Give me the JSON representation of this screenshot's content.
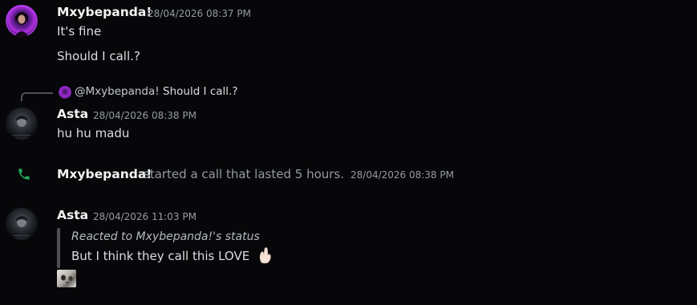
{
  "messages": [
    {
      "author": "Mxybepanda!",
      "timestamp": "28/04/2026 08:37 PM",
      "lines": [
        "It's fine",
        "Should I call.?"
      ]
    },
    {
      "reply": {
        "mention": "@Mxybepanda!",
        "text": "Should I call.?"
      },
      "author": "Asta",
      "timestamp": "28/04/2026 08:38 PM",
      "lines": [
        "hu hu madu"
      ]
    },
    {
      "system": true,
      "author": "Mxybepanda!",
      "text": "started a call that lasted 5 hours.",
      "timestamp": "28/04/2026 08:38 PM",
      "icon": "phone-icon",
      "icon_color": "#23a55a"
    },
    {
      "author": "Asta",
      "timestamp": "28/04/2026 11:03 PM",
      "quote_header": "Reacted to Mxybepanda!'s status",
      "quote_body": "But I think they call this LOVE",
      "emoji": "pinching-hand-emoji",
      "attachment": "sticker-thumbnail"
    }
  ],
  "colors": {
    "background": "#070709",
    "author": "#f2f3f5",
    "timestamp": "#949ba4",
    "text": "#dbdee1",
    "call_green": "#23a55a"
  }
}
